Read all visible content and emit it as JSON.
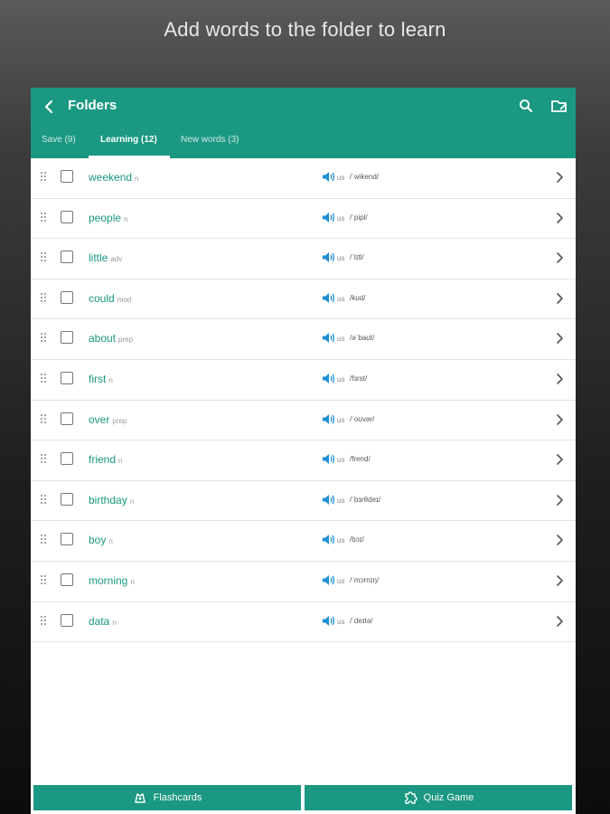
{
  "promo": {
    "text": "Add words to the folder to learn"
  },
  "appbar": {
    "title": "Folders",
    "accent": "#1a9882"
  },
  "tabs": [
    {
      "label": "Save (9)",
      "active": false
    },
    {
      "label": "Learning (12)",
      "active": true
    },
    {
      "label": "New words (3)",
      "active": false
    }
  ],
  "words": [
    {
      "word": "weekend",
      "pos": "n",
      "region": "us",
      "ipa": "/ˈwikend/"
    },
    {
      "word": "people",
      "pos": "n",
      "region": "us",
      "ipa": "/ˈpipl/"
    },
    {
      "word": "little",
      "pos": "adv",
      "region": "us",
      "ipa": "/ˈlɪtl/"
    },
    {
      "word": "could",
      "pos": "mod",
      "region": "us",
      "ipa": "/kʊd/"
    },
    {
      "word": "about",
      "pos": "prep",
      "region": "us",
      "ipa": "/əˈbaʊt/"
    },
    {
      "word": "first",
      "pos": "n",
      "region": "us",
      "ipa": "/fɜrst/"
    },
    {
      "word": "over",
      "pos": "prep",
      "region": "us",
      "ipa": "/ˈoʊvər/"
    },
    {
      "word": "friend",
      "pos": "n",
      "region": "us",
      "ipa": "/frend/"
    },
    {
      "word": "birthday",
      "pos": "n",
      "region": "us",
      "ipa": "/ˈbɜrθdeɪ/"
    },
    {
      "word": "boy",
      "pos": "n",
      "region": "us",
      "ipa": "/bɔɪ/"
    },
    {
      "word": "morning",
      "pos": "n",
      "region": "us",
      "ipa": "/ˈmɔrnɪŋ/"
    },
    {
      "word": "data",
      "pos": "n",
      "region": "us",
      "ipa": "/ˈdeɪtə/"
    }
  ],
  "bottom": {
    "flashcards_label": "Flashcards",
    "quiz_label": "Quiz Game"
  }
}
